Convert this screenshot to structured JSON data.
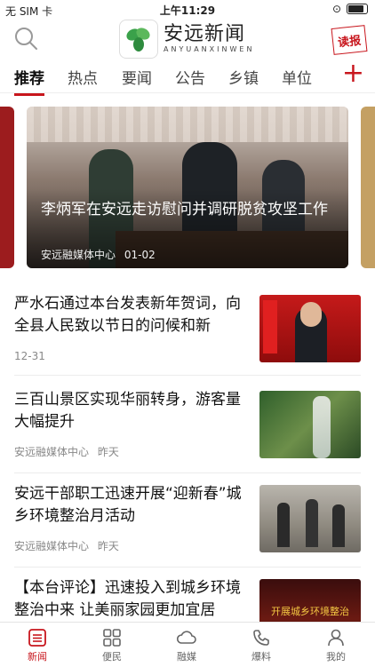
{
  "status_bar": {
    "carrier": "无 SIM 卡",
    "time": "上午11:29"
  },
  "header": {
    "logo_cn": "安远新闻",
    "logo_en": "ANYUANXINWEN",
    "read_paper": "读报"
  },
  "tabs": [
    "推荐",
    "热点",
    "要闻",
    "公告",
    "乡镇",
    "单位"
  ],
  "carousel": {
    "title": "李炳军在安远走访慰问并调研脱贫攻坚工作",
    "source": "安远融媒体中心",
    "date": "01-02"
  },
  "news": [
    {
      "title": "严水石通过本台发表新年贺词，向全县人民致以节日的问候和新",
      "source": "",
      "date": "12-31"
    },
    {
      "title": "三百山景区实现华丽转身，游客量大幅提升",
      "source": "安远融媒体中心",
      "date": "昨天"
    },
    {
      "title": "安远干部职工迅速开展“迎新春”城乡环境整治月活动",
      "source": "安远融媒体中心",
      "date": "昨天"
    },
    {
      "title": "【本台评论】迅速投入到城乡环境整治中来 让美丽家园更加宜居",
      "thumb_caption": "开展城乡环境整治"
    }
  ],
  "tabbar": [
    "新闻",
    "便民",
    "融媒",
    "爆料",
    "我的"
  ],
  "colors": {
    "accent": "#c8161d"
  }
}
